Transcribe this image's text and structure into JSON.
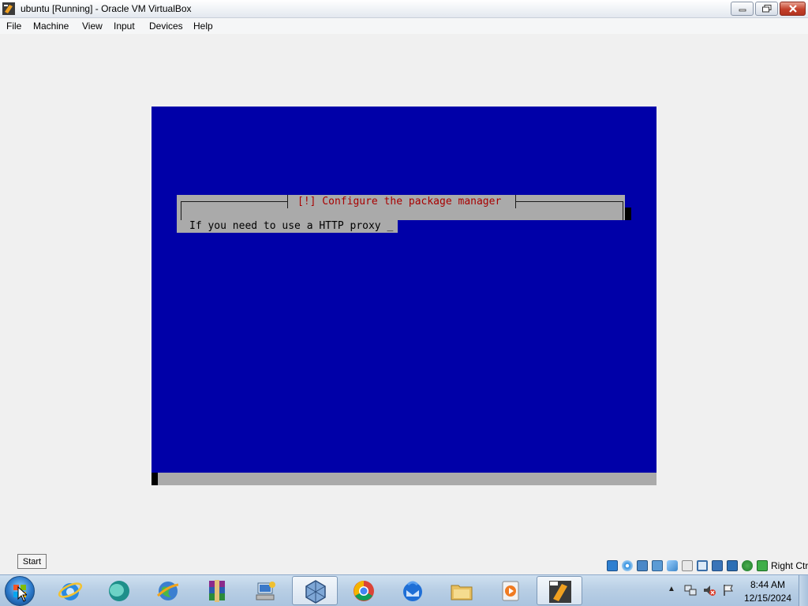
{
  "window": {
    "title": "ubuntu [Running] - Oracle VM VirtualBox",
    "minimize_label": "",
    "maximize_label": "",
    "close_label": ""
  },
  "menu": {
    "items": [
      "File",
      "Machine",
      "View",
      "Input",
      "Devices",
      "Help"
    ]
  },
  "vm": {
    "dialog_title": "[!] Configure the package manager",
    "dialog_text": "If you need to use a HTTP proxy _",
    "background_color": "#0000a8",
    "dialog_color": "#aaaaaa",
    "title_color": "#a80000"
  },
  "tooltip": {
    "text": "Start"
  },
  "statusbar": {
    "host_key": "Right Ctrl",
    "icons": [
      "hard-disk-icon",
      "optical-drive-icon",
      "audio-icon",
      "network-icon",
      "usb-icon",
      "shared-folders-icon",
      "display-icon",
      "recording-icon",
      "cpu-icon",
      "mouse-integration-icon",
      "keyboard-icon"
    ]
  },
  "taskbar": {
    "apps": [
      "internet-explorer-icon",
      "media-app-icon",
      "browser-globe-icon",
      "winrar-icon",
      "setup-wizard-icon",
      "virtualbox-icon",
      "chrome-icon",
      "thunderbird-icon",
      "file-explorer-icon",
      "media-player-icon",
      "virtualbox-vm-icon"
    ],
    "clock_time": "8:44 AM",
    "clock_date": "12/15/2024"
  }
}
